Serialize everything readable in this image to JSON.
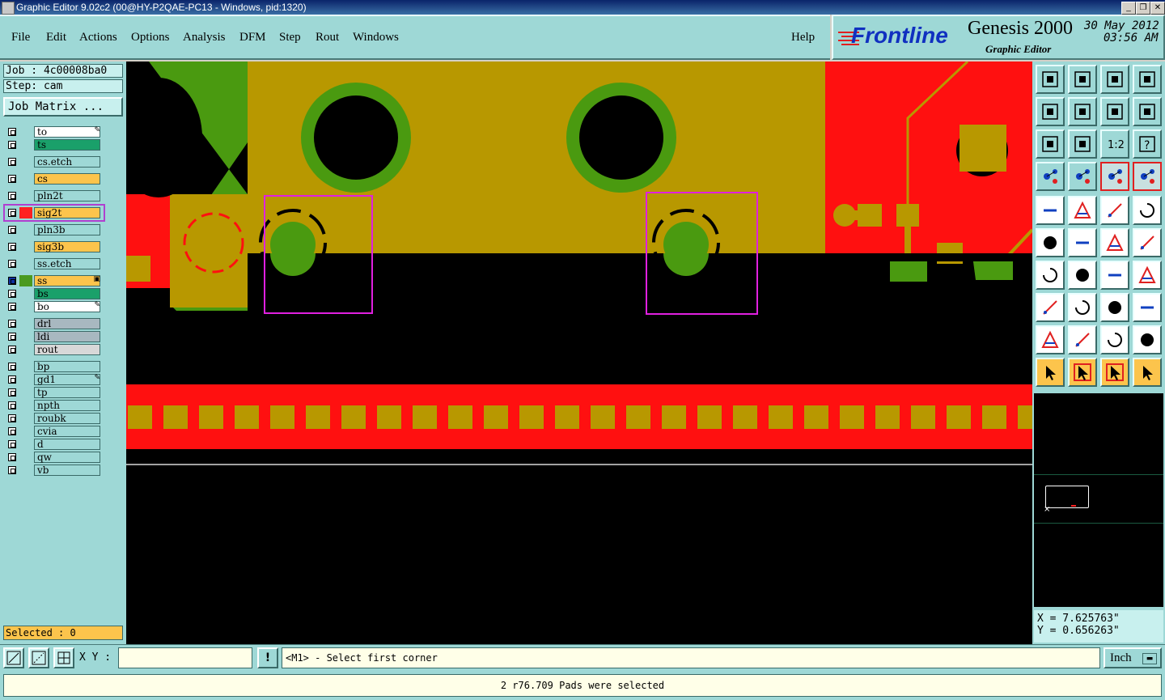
{
  "window": {
    "title": "Graphic Editor 9.02c2 (00@HY-P2QAE-PC13 - Windows, pid:1320)"
  },
  "menu": [
    "File",
    "Edit",
    "Actions",
    "Options",
    "Analysis",
    "DFM",
    "Step",
    "Rout",
    "Windows"
  ],
  "help_label": "Help",
  "brand": {
    "logo": "Frontline",
    "product": "Genesis 2000",
    "subtitle": "Graphic Editor",
    "date": "30 May 2012",
    "time": "03:56 AM"
  },
  "job": {
    "job_label": "Job : 4c00008ba0",
    "step_label": "Step: cam",
    "matrix_button": "Job Matrix ..."
  },
  "layers": [
    {
      "name": "to",
      "color": "#ffffff",
      "swatch": "#9ed8d6",
      "mark": "pen"
    },
    {
      "name": "ts",
      "color": "#1aa06a",
      "swatch": "#9ed8d6"
    },
    {
      "name": "cs.etch",
      "color": "#9ed8d6",
      "swatch": "#9ed8d6"
    },
    {
      "name": "cs",
      "color": "#fcc44c",
      "swatch": "#9ed8d6"
    },
    {
      "name": "pln2t",
      "color": "#9ed8d6",
      "swatch": "#9ed8d6"
    },
    {
      "name": "sig2t",
      "color": "#fcc44c",
      "swatch": "#ff2020",
      "highlighted": true
    },
    {
      "name": "pln3b",
      "color": "#9ed8d6",
      "swatch": "#9ed8d6"
    },
    {
      "name": "sig3b",
      "color": "#fcc44c",
      "swatch": "#9ed8d6"
    },
    {
      "name": "ss.etch",
      "color": "#9ed8d6",
      "swatch": "#9ed8d6"
    },
    {
      "name": "ss",
      "color": "#fcc44c",
      "swatch": "#4a9a20",
      "mark": "box",
      "checked": true
    },
    {
      "name": "bs",
      "color": "#1aa06a",
      "swatch": "#9ed8d6"
    },
    {
      "name": "bo",
      "color": "#ffffff",
      "swatch": "#9ed8d6",
      "mark": "pen"
    },
    {
      "name": "drl",
      "color": "#a8b8c0",
      "swatch": "#9ed8d6"
    },
    {
      "name": "ldi",
      "color": "#a8b8c0",
      "swatch": "#9ed8d6"
    },
    {
      "name": "rout",
      "color": "#d8d8d8",
      "swatch": "#9ed8d6"
    },
    {
      "name": "bp",
      "color": "#9ed8d6",
      "swatch": "#9ed8d6"
    },
    {
      "name": "gd1",
      "color": "#9ed8d6",
      "swatch": "#9ed8d6",
      "mark": "pen"
    },
    {
      "name": "tp",
      "color": "#9ed8d6",
      "swatch": "#9ed8d6"
    },
    {
      "name": "npth",
      "color": "#9ed8d6",
      "swatch": "#9ed8d6"
    },
    {
      "name": "roubk",
      "color": "#9ed8d6",
      "swatch": "#9ed8d6"
    },
    {
      "name": "cvia",
      "color": "#9ed8d6",
      "swatch": "#9ed8d6"
    },
    {
      "name": "d",
      "color": "#9ed8d6",
      "swatch": "#9ed8d6"
    },
    {
      "name": "qw",
      "color": "#9ed8d6",
      "swatch": "#9ed8d6"
    },
    {
      "name": "vb",
      "color": "#9ed8d6",
      "swatch": "#9ed8d6"
    }
  ],
  "selected_label": "Selected : 0",
  "coords": {
    "x": "X = 7.625763\"",
    "y": "Y = 0.656263\""
  },
  "toolbar_icons": [
    "zoom-home-icon",
    "zoom-fit-icon",
    "home-view-icon",
    "window-icon",
    "pan-left-icon",
    "pan-right-icon",
    "mirror-icon",
    "redraw-icon",
    "zoom-in-icon",
    "zoom-out-icon",
    "zoom-1-2-icon",
    "help-icon",
    "measure-icon",
    "snap-icon",
    "net-icon",
    "net2-icon",
    "fill-icon",
    "transform-icon",
    "ruler-icon",
    "pad-icon",
    "connect-icon",
    "delete-icon",
    "move-icon",
    "copy-icon",
    "line-icon",
    "arc-icon",
    "rotate-icon",
    "flip-icon",
    "stretch-icon",
    "cut-icon",
    "resize-icon",
    "shape-icon",
    "drc-icon",
    "drc2-icon",
    "drc3-icon",
    "drc4-icon",
    "select-icon",
    "select-box-icon",
    "select-poly-icon",
    "select-net-icon"
  ],
  "bottom": {
    "xy_label": "X Y :",
    "xy_value": "",
    "prompt": "<M1> - Select first corner",
    "units": "Inch"
  },
  "status": "2 r76.709 Pads were selected",
  "zoom_label": "1:2"
}
